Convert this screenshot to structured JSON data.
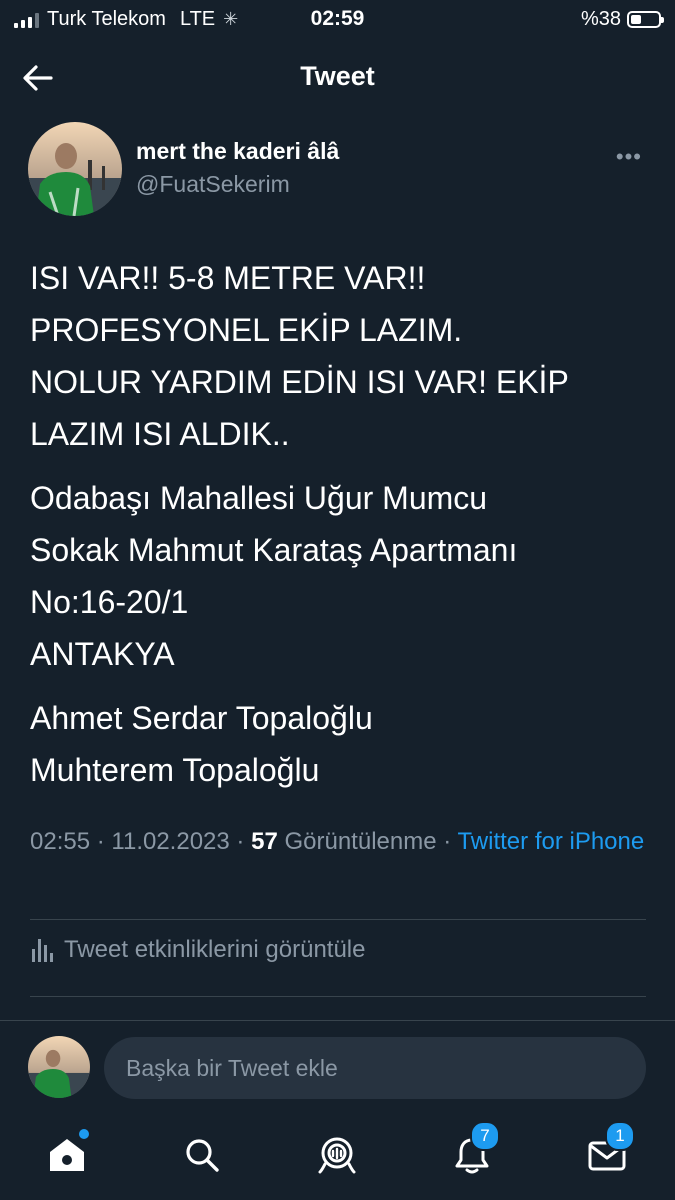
{
  "status_bar": {
    "carrier": "Turk Telekom",
    "network": "LTE",
    "time": "02:59",
    "battery": "%38",
    "battery_level": 0.38
  },
  "header": {
    "title": "Tweet"
  },
  "author": {
    "name": "mert the kaderi âlâ",
    "handle": "@FuatSekerim"
  },
  "tweet": {
    "paragraphs": [
      "ISI VAR!! 5-8 METRE VAR!!\nPROFESYONEL EKİP LAZIM.\nNOLUR YARDIM EDİN ISI VAR! EKİP\nLAZIM ISI ALDIK..",
      "Odabaşı Mahallesi Uğur Mumcu\nSokak Mahmut Karataş Apartmanı\nNo:16-20/1\nANTAKYA",
      "Ahmet Serdar Topaloğlu\nMuhterem Topaloğlu"
    ]
  },
  "meta": {
    "time": "02:55",
    "date": "11.02.2023",
    "views_count": "57",
    "views_label": "Görüntülenme",
    "separator": "·",
    "source": "Twitter for iPhone"
  },
  "analytics": {
    "label": "Tweet etkinliklerini görüntüle"
  },
  "reply": {
    "placeholder": "Başka bir Tweet ekle"
  },
  "tabs": {
    "notifications_badge": "7",
    "messages_badge": "1"
  },
  "colors": {
    "background": "#15202b",
    "accent": "#1d9bf0",
    "secondary_text": "#8b98a5",
    "divider": "#38444d"
  },
  "icons": [
    "back-arrow-icon",
    "more-icon",
    "analytics-icon",
    "home-icon",
    "search-icon",
    "spaces-icon",
    "bell-icon",
    "mail-icon"
  ]
}
